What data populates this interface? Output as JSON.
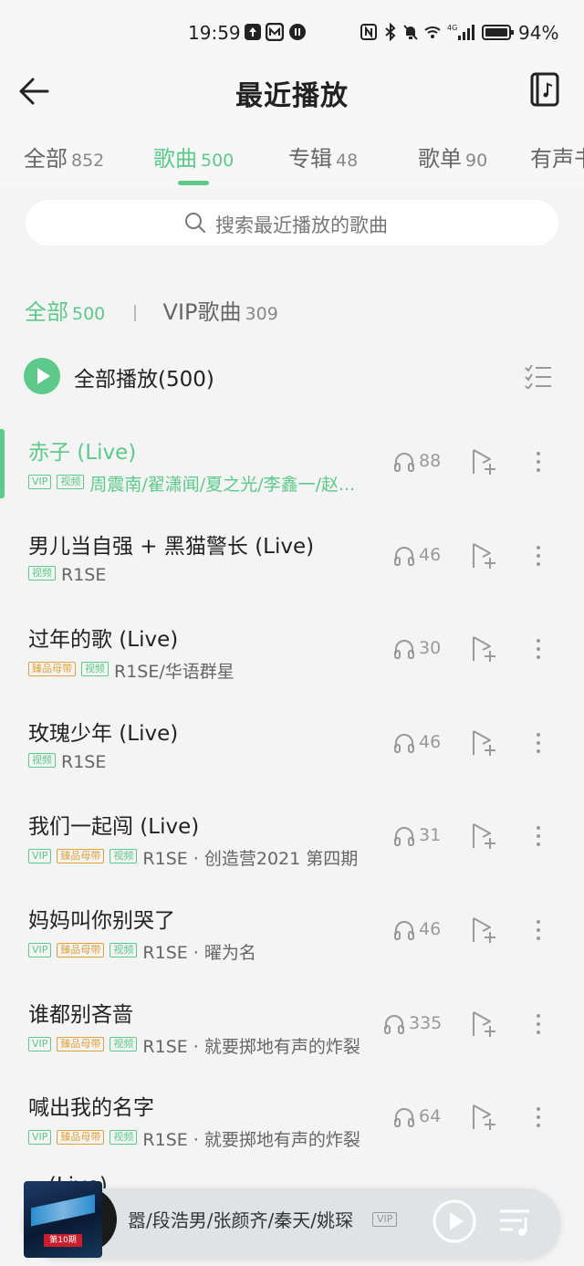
{
  "status_bar": {
    "time": "19:59",
    "battery": "94%"
  },
  "header": {
    "title": "最近播放"
  },
  "tabs": [
    {
      "label": "全部",
      "count": "852"
    },
    {
      "label": "歌曲",
      "count": "500"
    },
    {
      "label": "专辑",
      "count": "48"
    },
    {
      "label": "歌单",
      "count": "90"
    },
    {
      "label": "有声书",
      "count": ""
    }
  ],
  "search": {
    "placeholder": "搜索最近播放的歌曲"
  },
  "filters": [
    {
      "label": "全部",
      "count": "500"
    },
    {
      "label": "VIP歌曲",
      "count": "309"
    }
  ],
  "play_all": {
    "label": "全部播放(500)"
  },
  "songs": [
    {
      "title": "赤子 (Live)",
      "tags": [
        "VIP",
        "视频"
      ],
      "artist": "周震南/翟潇闻/夏之光/李鑫一/赵...",
      "plays": "88"
    },
    {
      "title": "男儿当自强 + 黑猫警长 (Live)",
      "tags": [
        "视频"
      ],
      "artist": "R1SE",
      "plays": "46"
    },
    {
      "title": "过年的歌 (Live)",
      "tags": [
        "臻品母带",
        "视频"
      ],
      "artist": "R1SE/华语群星",
      "plays": "30"
    },
    {
      "title": "玫瑰少年 (Live)",
      "tags": [
        "视频"
      ],
      "artist": "R1SE",
      "plays": "46"
    },
    {
      "title": "我们一起闯 (Live)",
      "tags": [
        "VIP",
        "臻品母带",
        "视频"
      ],
      "artist": "R1SE · 创造营2021 第四期",
      "plays": "31"
    },
    {
      "title": "妈妈叫你别哭了",
      "tags": [
        "VIP",
        "臻品母带",
        "视频"
      ],
      "artist": "R1SE · 曜为名",
      "plays": "46"
    },
    {
      "title": "谁都别吝啬",
      "tags": [
        "VIP",
        "臻品母带",
        "视频"
      ],
      "artist": "R1SE · 就要掷地有声的炸裂",
      "plays": "335"
    },
    {
      "title": "喊出我的名字",
      "tags": [
        "VIP",
        "臻品母带",
        "视频"
      ],
      "artist": "R1SE · 就要掷地有声的炸裂",
      "plays": "64"
    }
  ],
  "partial_song": {
    "title": "...(Live)"
  },
  "now_playing": {
    "text": "嚣/段浩男/张颜齐/秦天/姚琛",
    "badge": "VIP",
    "cover_label": "第10期"
  }
}
